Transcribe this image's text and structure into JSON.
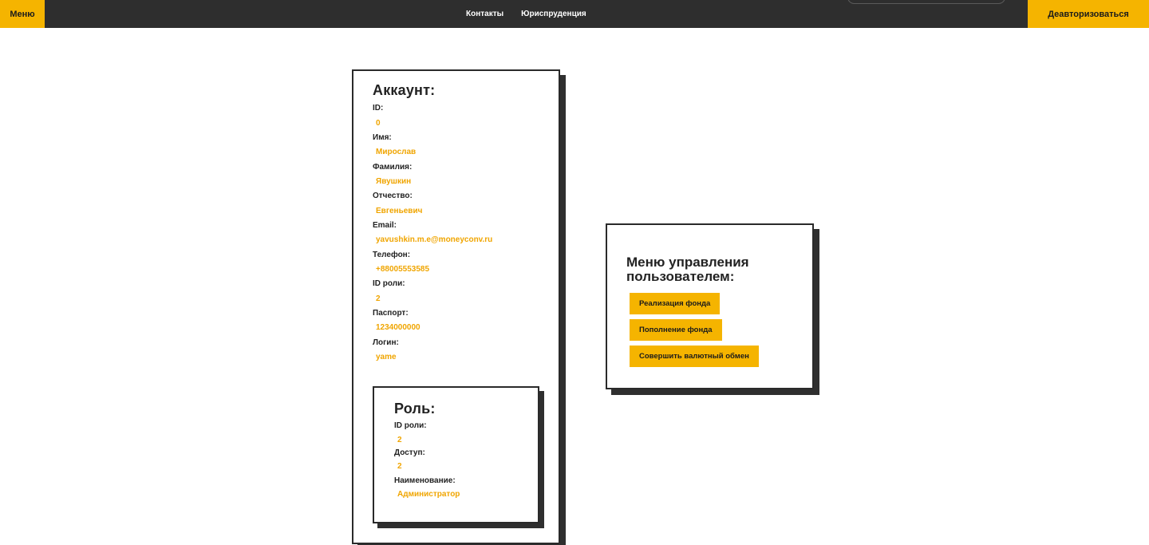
{
  "header": {
    "menu_label": "Меню",
    "nav": [
      "Контакты",
      "Юриспруденция"
    ],
    "logout_label": "Деавторизоваться"
  },
  "account": {
    "title": "Аккаунт:",
    "fields": [
      {
        "label": "ID:",
        "value": "0"
      },
      {
        "label": "Имя:",
        "value": "Мирослав"
      },
      {
        "label": "Фамилия:",
        "value": "Явушкин"
      },
      {
        "label": "Отчество:",
        "value": "Евгеньевич"
      },
      {
        "label": "Email:",
        "value": "yavushkin.m.e@moneyconv.ru"
      },
      {
        "label": "Телефон:",
        "value": "+88005553585"
      },
      {
        "label": "ID роли:",
        "value": "2"
      },
      {
        "label": "Паспорт:",
        "value": "1234000000"
      },
      {
        "label": "Логин:",
        "value": "yame"
      }
    ]
  },
  "role": {
    "title": "Роль:",
    "fields": [
      {
        "label": "ID роли:",
        "value": "2"
      },
      {
        "label": "Доступ:",
        "value": "2"
      },
      {
        "label": "Наименование:",
        "value": "Администратор"
      }
    ]
  },
  "user_menu": {
    "title": "Меню управления пользователем:",
    "buttons": [
      "Реализация фонда",
      "Пополнение фонда",
      "Совершить валютный обмен"
    ]
  },
  "colors": {
    "accent": "#f5b400",
    "value_text": "#f0a500",
    "header_bg": "#2e2e2e"
  }
}
